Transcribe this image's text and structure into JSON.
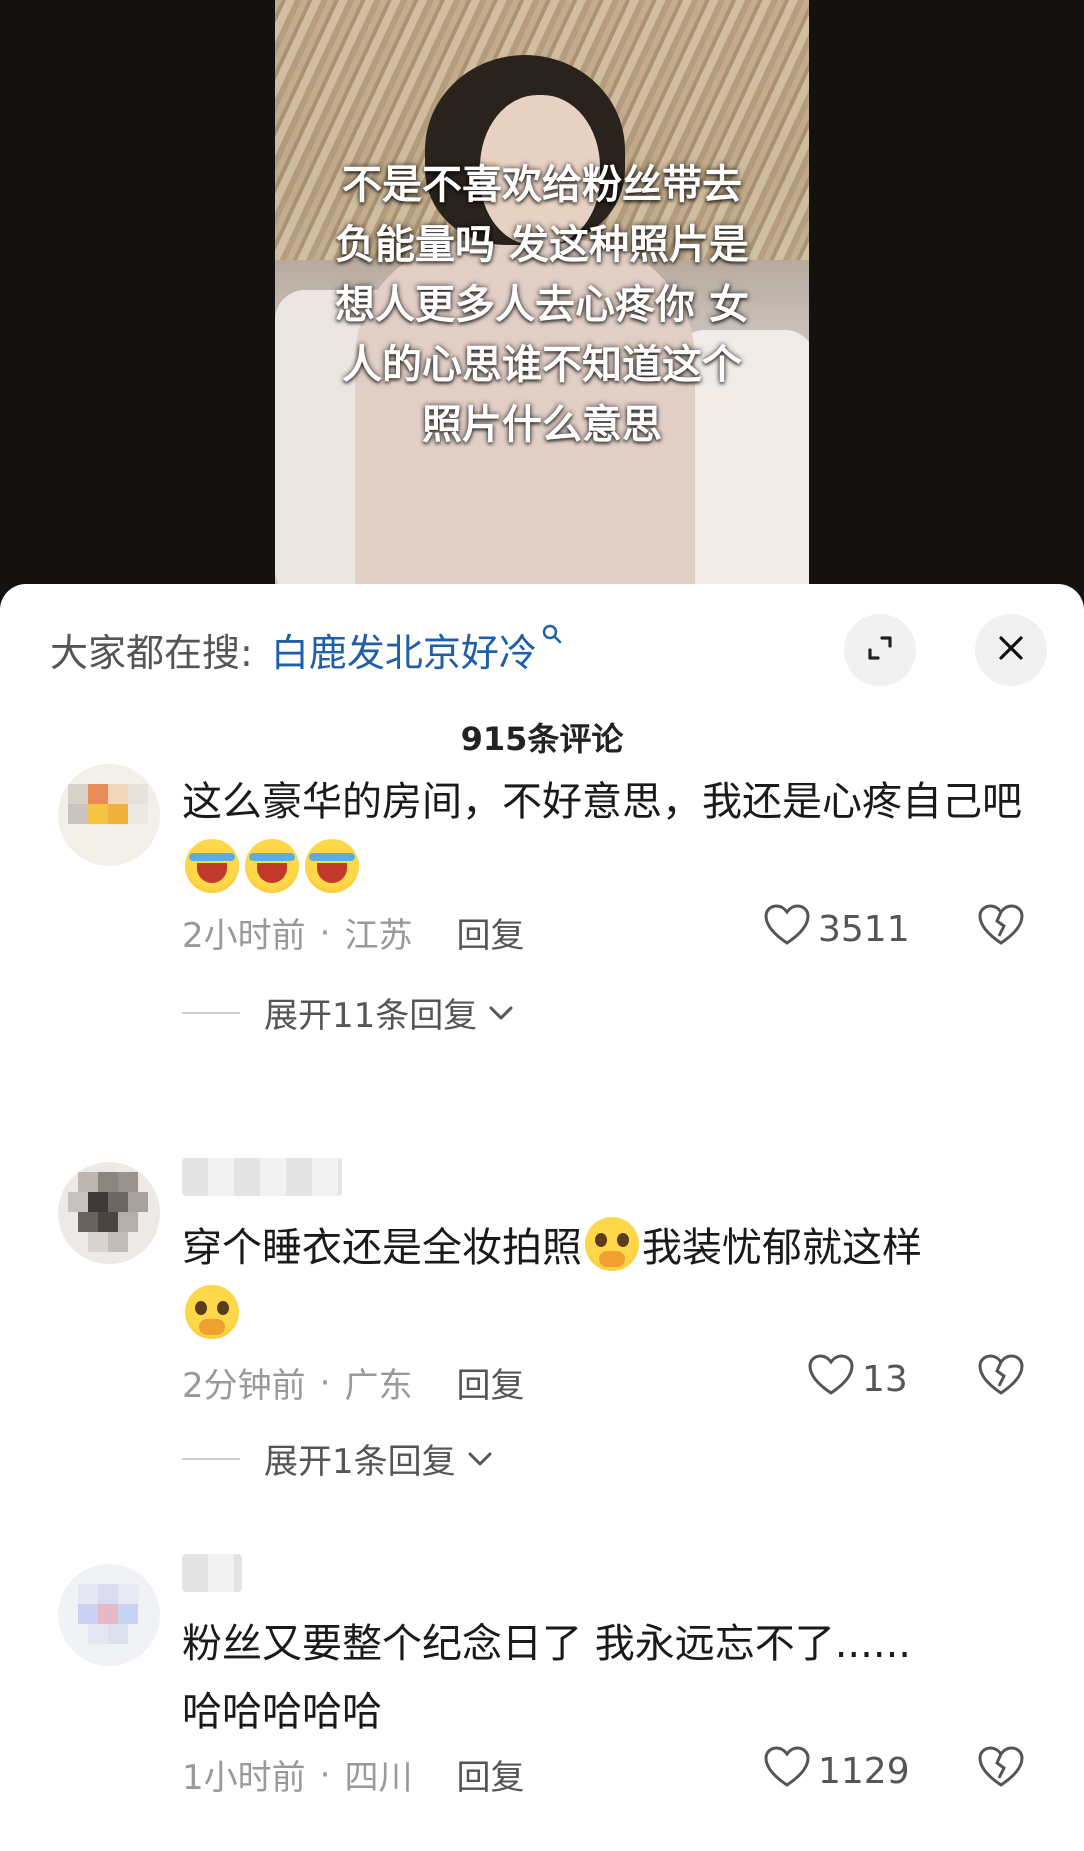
{
  "video": {
    "overlay_text": "不是不喜欢给粉丝带去\n负能量吗 发这种照片是\n想人更多人去心疼你 女\n人的心思谁不知道这个\n照片什么意思"
  },
  "panel": {
    "search_label": "大家都在搜:",
    "search_term": "白鹿发北京好冷",
    "comment_count": "915条评论"
  },
  "comments": [
    {
      "text": "这么豪华的房间，不好意思，我还是心疼自己吧",
      "emoji": "loudly-crying-face-x3",
      "time": "2小时前",
      "location": "江苏",
      "reply_label": "回复",
      "likes": "3511",
      "expand_label": "展开11条回复"
    },
    {
      "text_part1": "穿个睡衣还是全妆拍照",
      "text_part2": "我装忧郁就这样",
      "emoji": "face-holding-back-tears",
      "time": "2分钟前",
      "location": "广东",
      "reply_label": "回复",
      "likes": "13",
      "expand_label": "展开1条回复"
    },
    {
      "text": "粉丝又要整个纪念日了 我永远忘不了......\n哈哈哈哈哈",
      "time": "1小时前",
      "location": "四川",
      "reply_label": "回复",
      "likes": "1129"
    }
  ]
}
